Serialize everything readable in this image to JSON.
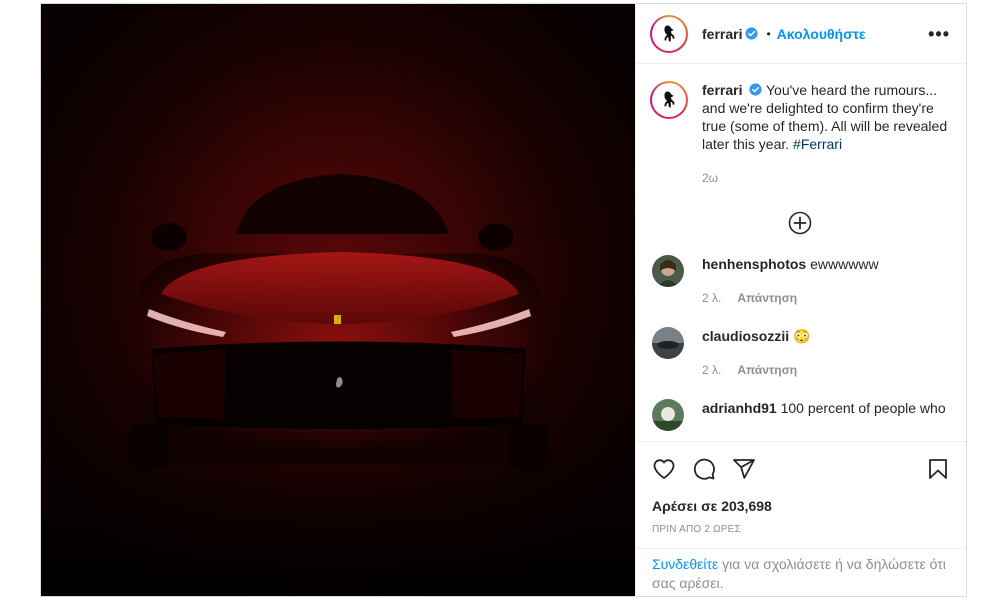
{
  "post": {
    "username": "ferrari",
    "follow_label": "Ακολουθήστε",
    "dot": "•",
    "more": "•••"
  },
  "caption": {
    "username": "ferrari",
    "text": "You've heard the rumours... and we're delighted to confirm they're true (some of them). All will be revealed later this year.",
    "hashtag": "#Ferrari",
    "time": "2ω"
  },
  "comments": [
    {
      "username": "henhensphotos",
      "text": "ewwwwww",
      "time": "2 λ.",
      "reply": "Απάντηση"
    },
    {
      "username": "claudiosozzii",
      "text": "😳",
      "time": "2 λ.",
      "reply": "Απάντηση"
    },
    {
      "username": "adrianhd91",
      "text": "100 percent of people who",
      "time": "",
      "reply": ""
    }
  ],
  "footer": {
    "likes": "Αρέσει σε 203,698",
    "ago": "ΠΡΙΝ ΑΠΟ 2 ΩΡΕΣ",
    "login_link": "Συνδεθείτε",
    "login_text": " για να σχολιάσετε ή να δηλώσετε ότι σας αρέσει."
  },
  "colors": {
    "accent": "#0095f6",
    "hashtag": "#00376b",
    "muted": "#8e8e8e"
  }
}
